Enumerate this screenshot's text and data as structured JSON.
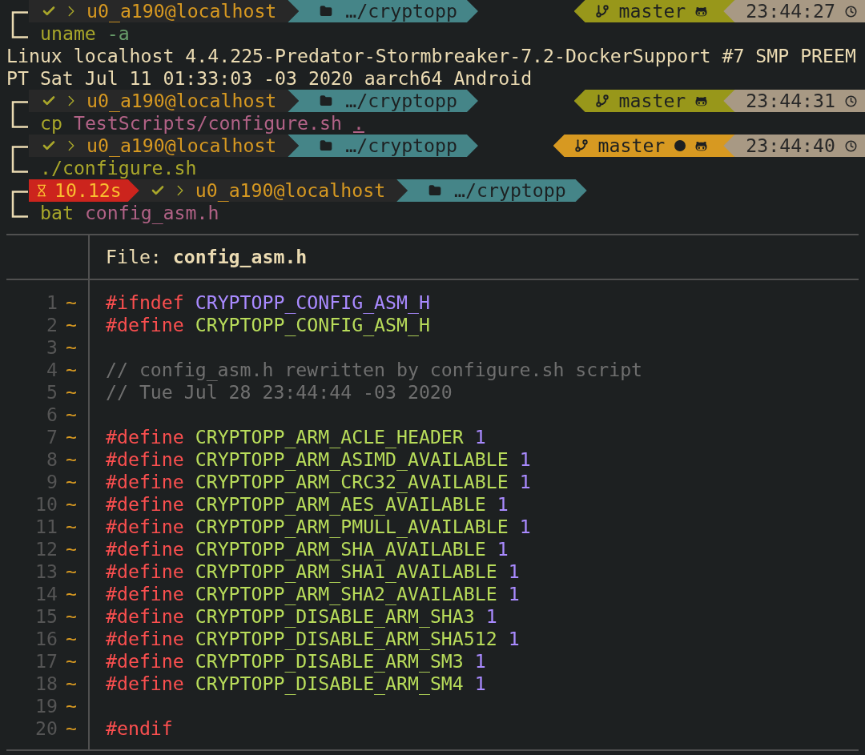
{
  "session": [
    {
      "kind": "prompt",
      "succeeded": true,
      "user_host": "u0_a190@localhost",
      "path": "…/cryptopp",
      "git": {
        "branch": "master",
        "dirty": false
      },
      "time": "23:44:27",
      "command": [
        {
          "text": "uname",
          "kind": "command",
          "underlined": false
        },
        {
          "text": "-a",
          "kind": "flag",
          "underlined": false
        }
      ]
    },
    {
      "kind": "output",
      "lines": [
        "Linux localhost 4.4.225-Predator-Stormbreaker-7.2-DockerSupport #7 SMP PREEM",
        "PT Sat Jul 11 01:33:03 -03 2020 aarch64 Android"
      ]
    },
    {
      "kind": "prompt",
      "succeeded": true,
      "user_host": "u0_a190@localhost",
      "path": "…/cryptopp",
      "git": {
        "branch": "master",
        "dirty": false
      },
      "time": "23:44:31",
      "command": [
        {
          "text": "cp",
          "kind": "command",
          "underlined": false
        },
        {
          "text": "TestScripts/configure.sh",
          "kind": "path",
          "underlined": false
        },
        {
          "text": ".",
          "kind": "path",
          "underlined": true
        }
      ]
    },
    {
      "kind": "prompt",
      "succeeded": true,
      "user_host": "u0_a190@localhost",
      "path": "…/cryptopp",
      "git": {
        "branch": "master",
        "dirty": true
      },
      "time": "23:44:40",
      "command": [
        {
          "text": "./configure.sh",
          "kind": "command",
          "underlined": false
        }
      ]
    },
    {
      "kind": "prompt",
      "succeeded": true,
      "duration": "10.12s",
      "user_host": "u0_a190@localhost",
      "path": "…/cryptopp",
      "command": [
        {
          "text": "bat",
          "kind": "command",
          "underlined": false
        },
        {
          "text": "config_asm.h",
          "kind": "path",
          "underlined": false
        }
      ]
    }
  ],
  "viewer": {
    "header_label": "File:",
    "filename": "config_asm.h",
    "lines": [
      {
        "number": "1",
        "change": "~",
        "tokens": [
          {
            "text": "#ifndef",
            "kind": "keyword"
          },
          {
            "text": "CRYPTOPP_CONFIG_ASM_H",
            "kind": "constant"
          }
        ]
      },
      {
        "number": "2",
        "change": "~",
        "tokens": [
          {
            "text": "#define",
            "kind": "keyword"
          },
          {
            "text": "CRYPTOPP_CONFIG_ASM_H",
            "kind": "identifier"
          }
        ]
      },
      {
        "number": "3",
        "change": "~"
      },
      {
        "number": "4",
        "change": "~",
        "tokens": [
          {
            "text": "// config_asm.h rewritten by configure.sh script",
            "kind": "comment"
          }
        ]
      },
      {
        "number": "5",
        "change": "~",
        "tokens": [
          {
            "text": "// Tue Jul 28 23:44:44 -03 2020",
            "kind": "comment"
          }
        ]
      },
      {
        "number": "6",
        "change": "~"
      },
      {
        "number": "7",
        "change": "~",
        "tokens": [
          {
            "text": "#define",
            "kind": "keyword"
          },
          {
            "text": "CRYPTOPP_ARM_ACLE_HEADER",
            "kind": "identifier"
          },
          {
            "text": "1",
            "kind": "number"
          }
        ]
      },
      {
        "number": "8",
        "change": "~",
        "tokens": [
          {
            "text": "#define",
            "kind": "keyword"
          },
          {
            "text": "CRYPTOPP_ARM_ASIMD_AVAILABLE",
            "kind": "identifier"
          },
          {
            "text": "1",
            "kind": "number"
          }
        ]
      },
      {
        "number": "9",
        "change": "~",
        "tokens": [
          {
            "text": "#define",
            "kind": "keyword"
          },
          {
            "text": "CRYPTOPP_ARM_CRC32_AVAILABLE",
            "kind": "identifier"
          },
          {
            "text": "1",
            "kind": "number"
          }
        ]
      },
      {
        "number": "10",
        "change": "~",
        "tokens": [
          {
            "text": "#define",
            "kind": "keyword"
          },
          {
            "text": "CRYPTOPP_ARM_AES_AVAILABLE",
            "kind": "identifier"
          },
          {
            "text": "1",
            "kind": "number"
          }
        ]
      },
      {
        "number": "11",
        "change": "~",
        "tokens": [
          {
            "text": "#define",
            "kind": "keyword"
          },
          {
            "text": "CRYPTOPP_ARM_PMULL_AVAILABLE",
            "kind": "identifier"
          },
          {
            "text": "1",
            "kind": "number"
          }
        ]
      },
      {
        "number": "12",
        "change": "~",
        "tokens": [
          {
            "text": "#define",
            "kind": "keyword"
          },
          {
            "text": "CRYPTOPP_ARM_SHA_AVAILABLE",
            "kind": "identifier"
          },
          {
            "text": "1",
            "kind": "number"
          }
        ]
      },
      {
        "number": "13",
        "change": "~",
        "tokens": [
          {
            "text": "#define",
            "kind": "keyword"
          },
          {
            "text": "CRYPTOPP_ARM_SHA1_AVAILABLE",
            "kind": "identifier"
          },
          {
            "text": "1",
            "kind": "number"
          }
        ]
      },
      {
        "number": "14",
        "change": "~",
        "tokens": [
          {
            "text": "#define",
            "kind": "keyword"
          },
          {
            "text": "CRYPTOPP_ARM_SHA2_AVAILABLE",
            "kind": "identifier"
          },
          {
            "text": "1",
            "kind": "number"
          }
        ]
      },
      {
        "number": "15",
        "change": "~",
        "tokens": [
          {
            "text": "#define",
            "kind": "keyword"
          },
          {
            "text": "CRYPTOPP_DISABLE_ARM_SHA3",
            "kind": "identifier"
          },
          {
            "text": "1",
            "kind": "number"
          }
        ]
      },
      {
        "number": "16",
        "change": "~",
        "tokens": [
          {
            "text": "#define",
            "kind": "keyword"
          },
          {
            "text": "CRYPTOPP_DISABLE_ARM_SHA512",
            "kind": "identifier"
          },
          {
            "text": "1",
            "kind": "number"
          }
        ]
      },
      {
        "number": "17",
        "change": "~",
        "tokens": [
          {
            "text": "#define",
            "kind": "keyword"
          },
          {
            "text": "CRYPTOPP_DISABLE_ARM_SM3",
            "kind": "identifier"
          },
          {
            "text": "1",
            "kind": "number"
          }
        ]
      },
      {
        "number": "18",
        "change": "~",
        "tokens": [
          {
            "text": "#define",
            "kind": "keyword"
          },
          {
            "text": "CRYPTOPP_DISABLE_ARM_SM4",
            "kind": "identifier"
          },
          {
            "text": "1",
            "kind": "number"
          }
        ]
      },
      {
        "number": "19",
        "change": "~"
      },
      {
        "number": "20",
        "change": "~",
        "tokens": [
          {
            "text": "#endif",
            "kind": "keyword"
          }
        ]
      }
    ]
  }
}
